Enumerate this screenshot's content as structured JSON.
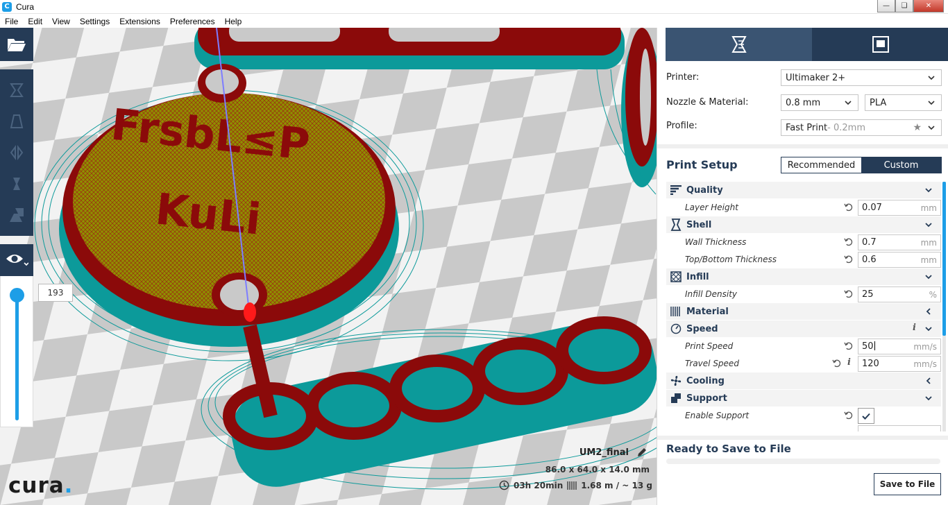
{
  "window": {
    "title": "Cura",
    "app_icon_letter": "C"
  },
  "menu": [
    "File",
    "Edit",
    "View",
    "Settings",
    "Extensions",
    "Preferences",
    "Help"
  ],
  "viewport": {
    "layer_number": "193",
    "layer_slider_level": 0.97,
    "model_name": "UM2_final",
    "dimensions": "86.0 x 64.0 x 14.0 mm",
    "print_time": "03h 20min",
    "material_usage": "1.68 m / ~ 13 g",
    "logo_text": "cura",
    "logo_dot": "."
  },
  "colors": {
    "accent": "#1d9ee7",
    "navy": "#253b56",
    "model_red": "#8b0a0a",
    "infill_olive": "#8f8f00",
    "support_teal": "#0c9a9a"
  },
  "sidebar": {
    "printer_label": "Printer:",
    "printer_value": "Ultimaker 2+",
    "nozzle_label": "Nozzle & Material:",
    "nozzle_value": "0.8 mm",
    "material_value": "PLA",
    "profile_label": "Profile:",
    "profile_value": "Fast Print",
    "profile_suffix": " - 0.2mm",
    "setup_title": "Print Setup",
    "mode_recommended": "Recommended",
    "mode_custom": "Custom",
    "categories": {
      "quality": "Quality",
      "shell": "Shell",
      "infill": "Infill",
      "material": "Material",
      "speed": "Speed",
      "cooling": "Cooling",
      "support": "Support"
    },
    "settings": {
      "layer_height": {
        "label": "Layer Height",
        "value": "0.07",
        "unit": "mm"
      },
      "wall_thickness": {
        "label": "Wall Thickness",
        "value": "0.7",
        "unit": "mm"
      },
      "top_bottom": {
        "label": "Top/Bottom Thickness",
        "value": "0.6",
        "unit": "mm"
      },
      "infill_density": {
        "label": "Infill Density",
        "value": "25",
        "unit": "%"
      },
      "print_speed": {
        "label": "Print Speed",
        "value": "50",
        "unit": "mm/s"
      },
      "travel_speed": {
        "label": "Travel Speed",
        "value": "120",
        "unit": "mm/s"
      },
      "enable_support": {
        "label": "Enable Support",
        "checked": true
      }
    },
    "info_glyph": "i",
    "ready_text": "Ready to Save to File",
    "save_button": "Save to File"
  }
}
